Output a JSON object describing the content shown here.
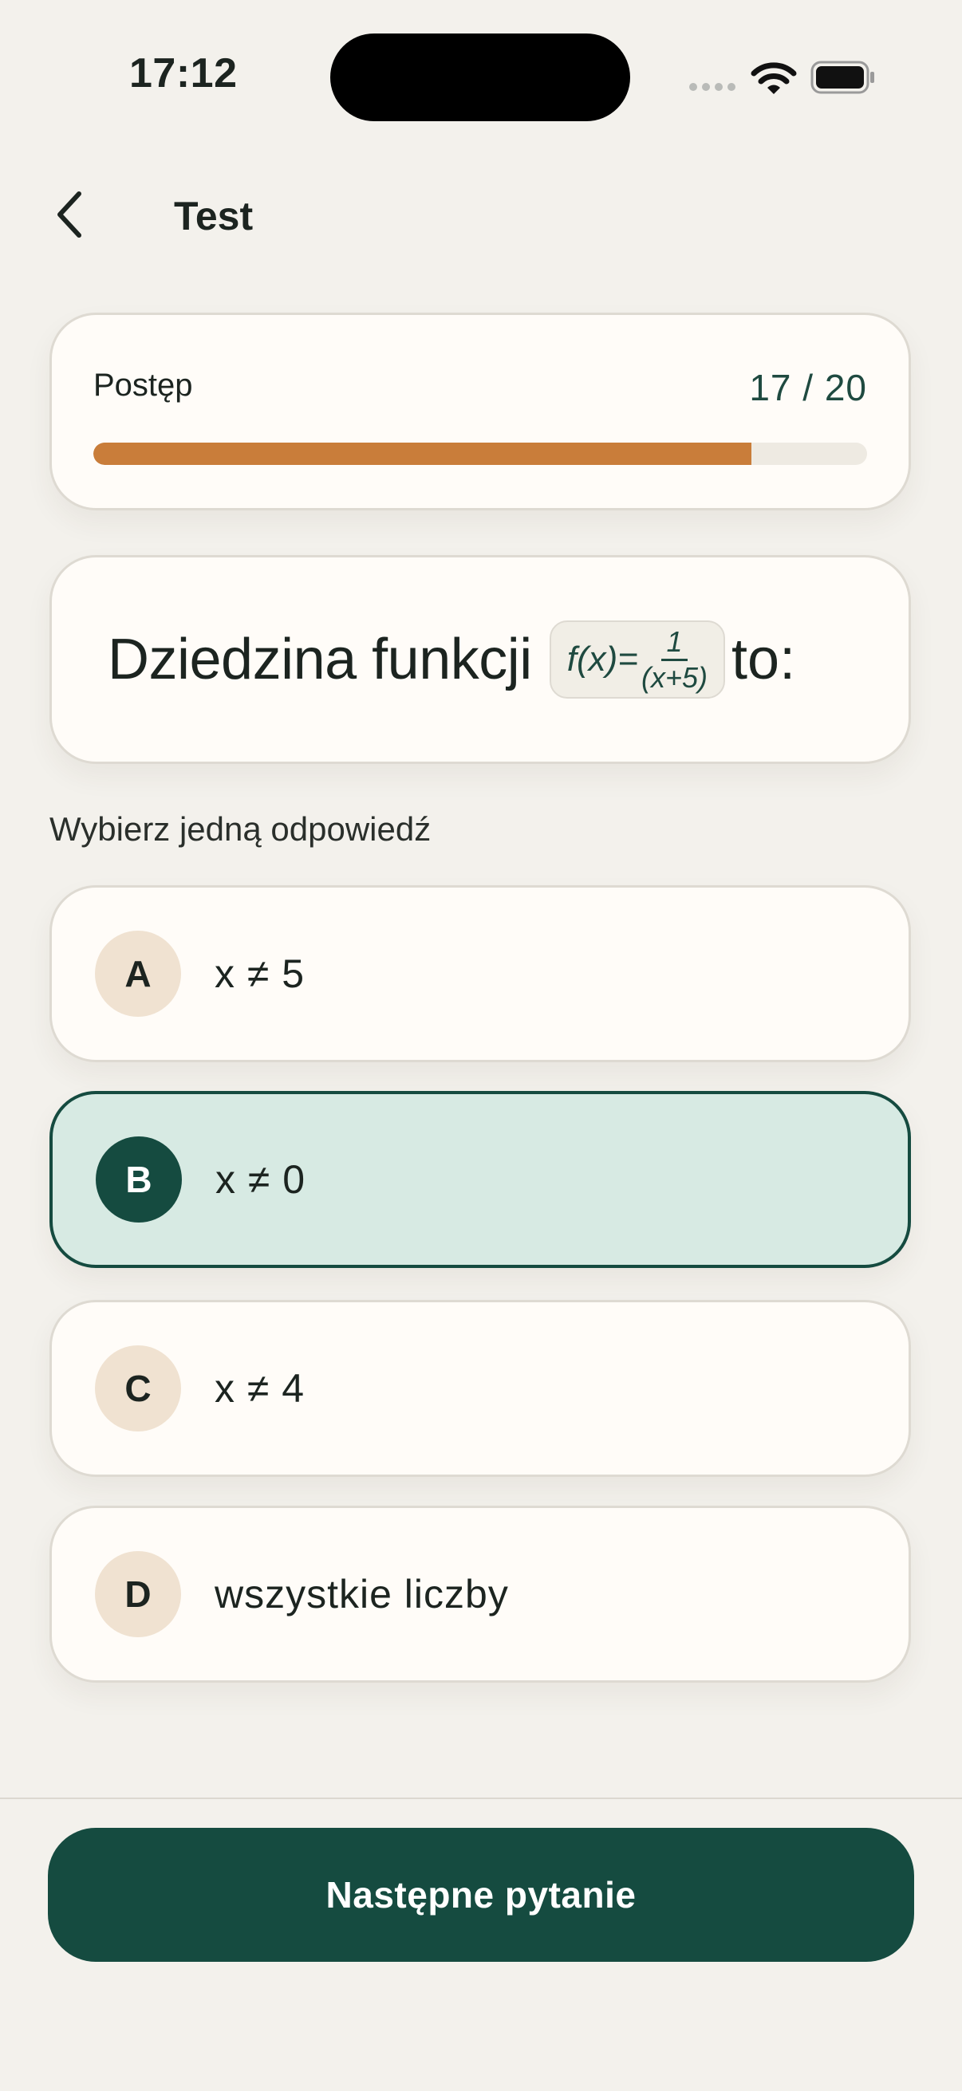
{
  "status_bar": {
    "time": "17:12"
  },
  "nav": {
    "title": "Test",
    "back_icon": "chevron-left-icon"
  },
  "progress": {
    "label": "Postęp",
    "count_text": "17 / 20",
    "current": 17,
    "total": 20,
    "fill_color": "#c97d3a"
  },
  "question": {
    "prefix": "Dziedzina funkcji",
    "formula_lhs": "f(x)=",
    "formula_numerator": "1",
    "formula_denominator": "(x+5)",
    "suffix": "to:"
  },
  "instruction": "Wybierz jedną odpowiedź",
  "options": [
    {
      "letter": "A",
      "text": "x ≠ 5",
      "selected": false
    },
    {
      "letter": "B",
      "text": "x ≠ 0",
      "selected": true
    },
    {
      "letter": "C",
      "text": "x ≠ 4",
      "selected": false
    },
    {
      "letter": "D",
      "text": "wszystkie liczby",
      "selected": false
    }
  ],
  "footer": {
    "next_label": "Następne pytanie"
  },
  "colors": {
    "accent": "#154b40",
    "selected_bg": "#d7eae3",
    "badge_bg": "#f0e2d1",
    "background": "#f3f1ec"
  }
}
